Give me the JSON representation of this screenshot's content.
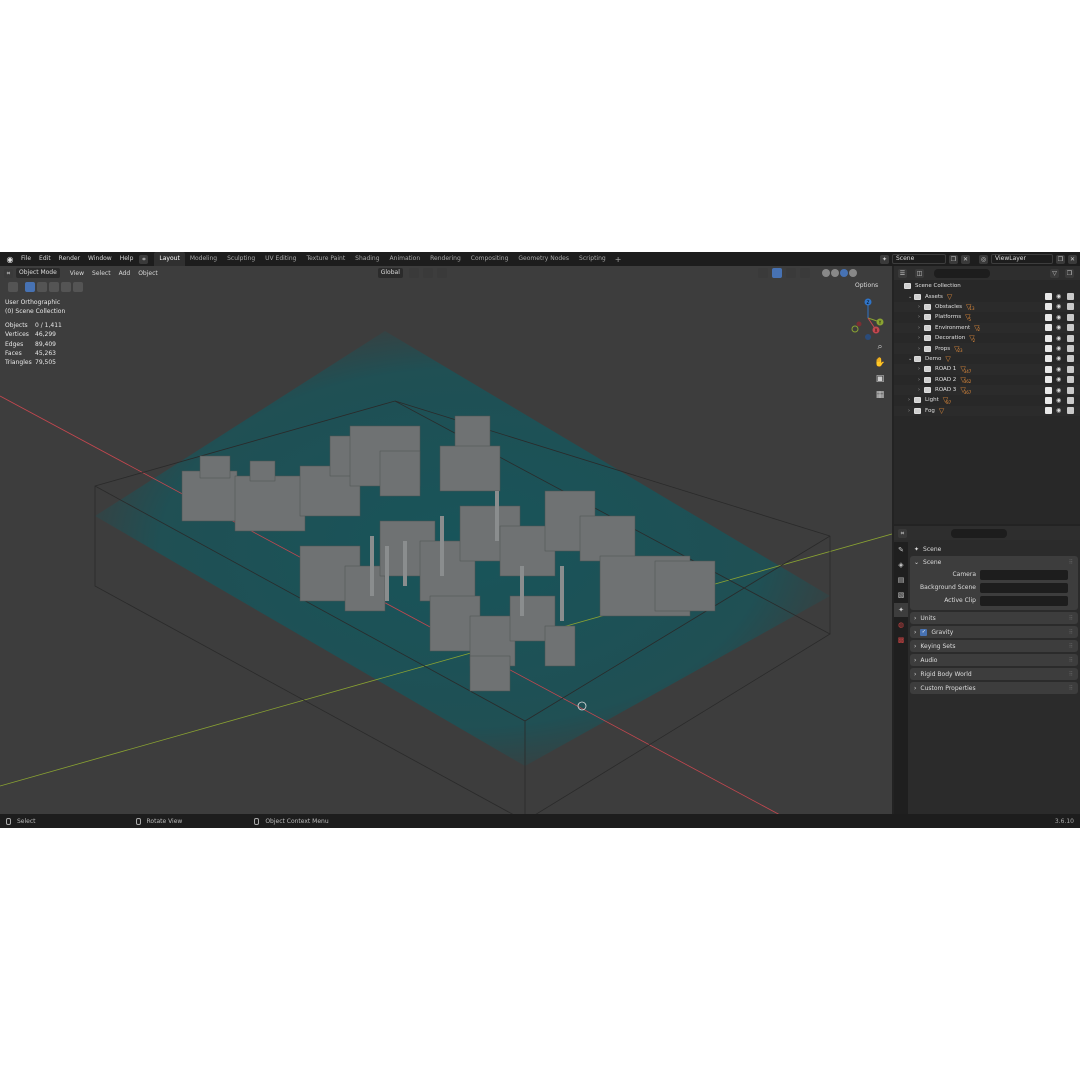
{
  "topbar": {
    "menus": [
      "File",
      "Edit",
      "Render",
      "Window",
      "Help"
    ],
    "workspaces": [
      "Layout",
      "Modeling",
      "Sculpting",
      "UV Editing",
      "Texture Paint",
      "Shading",
      "Animation",
      "Rendering",
      "Compositing",
      "Geometry Nodes",
      "Scripting"
    ],
    "active_workspace": "Layout",
    "add_tab": "+",
    "scene": "Scene",
    "view_layer": "ViewLayer"
  },
  "viewport": {
    "mode": "Object Mode",
    "menus": [
      "View",
      "Select",
      "Add",
      "Object"
    ],
    "orientation": "Global",
    "view_name": "User Orthographic",
    "collection_label": "(0) Scene Collection",
    "options_label": "Options",
    "stats": [
      {
        "label": "Objects",
        "value": "0 / 1,411"
      },
      {
        "label": "Vertices",
        "value": "46,299"
      },
      {
        "label": "Edges",
        "value": "89,409"
      },
      {
        "label": "Faces",
        "value": "45,263"
      },
      {
        "label": "Triangles",
        "value": "79,505"
      }
    ],
    "gizmo": {
      "z": "Z",
      "y": "Y",
      "x": "X"
    }
  },
  "outliner": {
    "search_placeholder": "",
    "root": "Scene Collection",
    "rows": [
      {
        "label": "Assets",
        "indent": 1,
        "badge": ""
      },
      {
        "label": "Obstacles",
        "indent": 2,
        "badge": "13"
      },
      {
        "label": "Platforms",
        "indent": 2,
        "badge": "5"
      },
      {
        "label": "Environment",
        "indent": 2,
        "badge": "2"
      },
      {
        "label": "Decoration",
        "indent": 2,
        "badge": "2"
      },
      {
        "label": "Props",
        "indent": 2,
        "badge": "23"
      },
      {
        "label": "Demo",
        "indent": 1,
        "badge": ""
      },
      {
        "label": "ROAD 1",
        "indent": 2,
        "badge": "347"
      },
      {
        "label": "ROAD 2",
        "indent": 2,
        "badge": "362"
      },
      {
        "label": "ROAD 3",
        "indent": 2,
        "badge": "367"
      },
      {
        "label": "Light",
        "indent": 1,
        "badge": "87"
      },
      {
        "label": "Fog",
        "indent": 1,
        "badge": ""
      }
    ]
  },
  "properties": {
    "context": "Scene",
    "panel_title": "Scene",
    "fields": [
      {
        "label": "Camera",
        "value": ""
      },
      {
        "label": "Background Scene",
        "value": ""
      },
      {
        "label": "Active Clip",
        "value": ""
      }
    ],
    "collapsed_panels": [
      "Units",
      "Gravity",
      "Keying Sets",
      "Audio",
      "Rigid Body World",
      "Custom Properties"
    ]
  },
  "statusbar": {
    "select": "Select",
    "rotate": "Rotate View",
    "context_menu": "Object Context Menu",
    "version": "3.6.10"
  },
  "colors": {
    "accent": "#4772b3",
    "fog": "#0f5a61",
    "x_axis": "#c4474f",
    "y_axis": "#8aa332",
    "collection_badge": "#e38c3b"
  }
}
